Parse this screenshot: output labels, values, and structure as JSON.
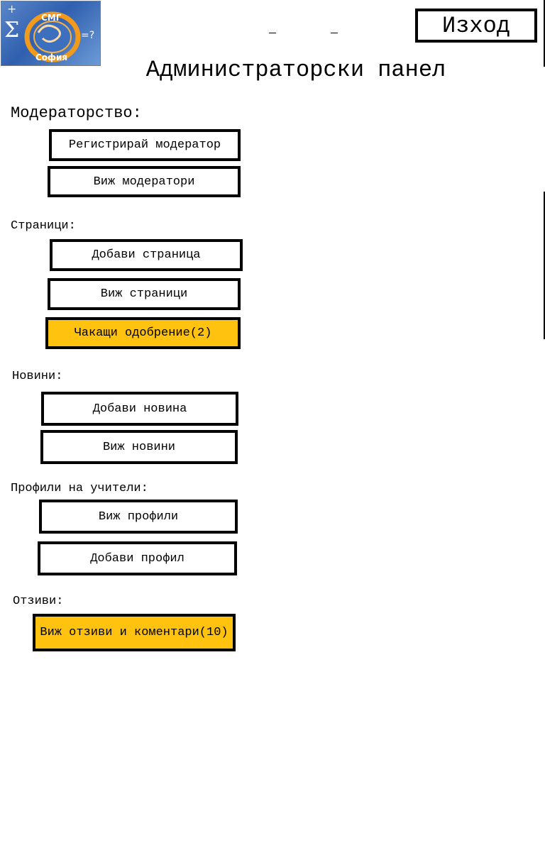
{
  "header": {
    "logo_text_top": "СМГ",
    "logo_text_bottom": "София",
    "logout_label": "Изход",
    "title": "Администраторски панел"
  },
  "sections": {
    "moderators": {
      "label": "Модераторство:",
      "register_label": "Регистрирай модератор",
      "view_label": "Виж модератори"
    },
    "pages": {
      "label": "Страници:",
      "add_label": "Добави страница",
      "view_label": "Виж страници",
      "pending_label": "Чакащи одобрение(2)"
    },
    "news": {
      "label": "Новини:",
      "add_label": "Добави новина",
      "view_label": "Виж новини"
    },
    "teacher_profiles": {
      "label": "Профили на учители:",
      "view_label": "Виж профили",
      "add_label": "Добави профил"
    },
    "reviews": {
      "label": "Отзиви:",
      "view_label": "Виж отзиви и коментари(10)"
    }
  },
  "colors": {
    "highlight": "#ffc20e",
    "border": "#000000",
    "logo_blue": "#2f5fae"
  },
  "icons": {
    "logo": "school-crest-logo"
  }
}
